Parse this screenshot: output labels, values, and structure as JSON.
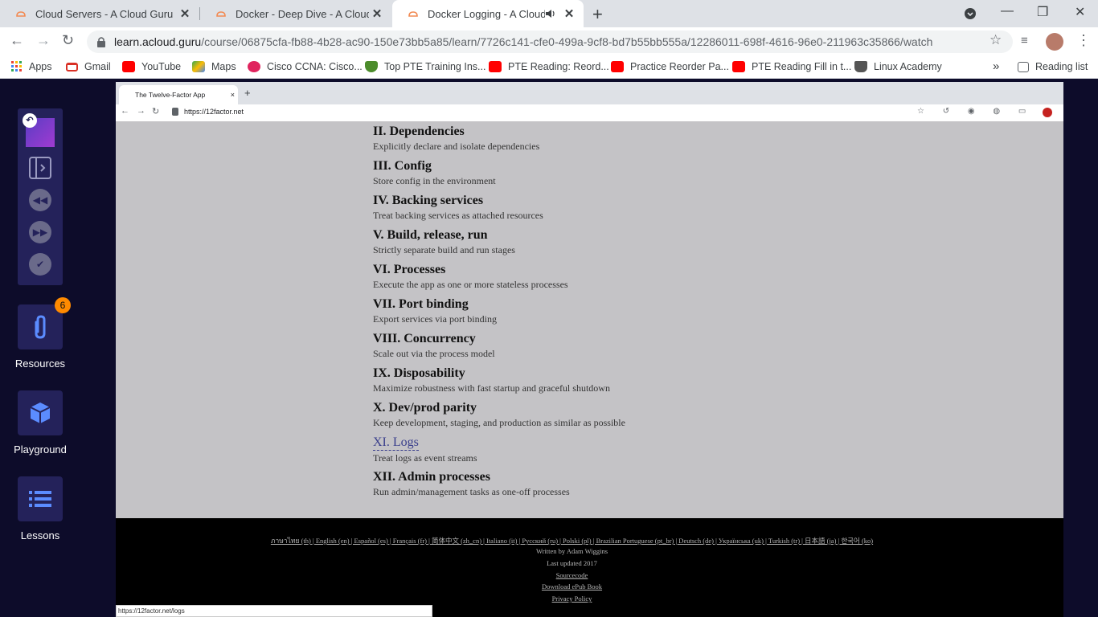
{
  "browser": {
    "tabs": [
      {
        "title": "Cloud Servers - A Cloud Guru",
        "close": "✕"
      },
      {
        "title": "Docker - Deep Dive - A Cloud Gu",
        "close": "✕"
      },
      {
        "title": "Docker Logging - A Cloud G",
        "close": "✕"
      }
    ],
    "new_tab": "+",
    "url_host": "learn.acloud.guru",
    "url_path": "/course/06875cfa-fb88-4b28-ac90-150e73bb5a85/learn/7726c141-cfe0-499a-9cf8-bd7b55bb555a/12286011-698f-4616-96e0-211963c35866/watch",
    "bookmarks": [
      {
        "label": "Apps",
        "icon": "apps-grid-icon",
        "color": "#ea4335"
      },
      {
        "label": "Gmail",
        "icon": "gmail-icon",
        "color": "#d93025"
      },
      {
        "label": "YouTube",
        "icon": "youtube-icon",
        "color": "#ff0000"
      },
      {
        "label": "Maps",
        "icon": "maps-icon",
        "color": "#34a853"
      },
      {
        "label": "Cisco CCNA: Cisco...",
        "icon": "cisco-icon",
        "color": "#e0245e"
      },
      {
        "label": "Top PTE Training Ins...",
        "icon": "shield-icon",
        "color": "#4c8c2b"
      },
      {
        "label": "PTE Reading: Reord...",
        "icon": "youtube-icon",
        "color": "#ff0000"
      },
      {
        "label": "Practice Reorder Pa...",
        "icon": "youtube-icon",
        "color": "#ff0000"
      },
      {
        "label": "PTE Reading Fill in t...",
        "icon": "youtube-icon",
        "color": "#ff0000"
      },
      {
        "label": "Linux Academy",
        "icon": "graduation-cap-icon",
        "color": "#555555"
      }
    ],
    "more": "»",
    "reading_list": "Reading list"
  },
  "sidebar": {
    "badge_count": "6",
    "resources": "Resources",
    "playground": "Playground",
    "lessons": "Lessons"
  },
  "inner": {
    "tab_title": "The Twelve-Factor App",
    "tab_close": "×",
    "new_tab": "+",
    "url": "https://12factor.net",
    "factors": [
      {
        "h": "II. Dependencies",
        "d": "Explicitly declare and isolate dependencies"
      },
      {
        "h": "III. Config",
        "d": "Store config in the environment"
      },
      {
        "h": "IV. Backing services",
        "d": "Treat backing services as attached resources"
      },
      {
        "h": "V. Build, release, run",
        "d": "Strictly separate build and run stages"
      },
      {
        "h": "VI. Processes",
        "d": "Execute the app as one or more stateless processes"
      },
      {
        "h": "VII. Port binding",
        "d": "Export services via port binding"
      },
      {
        "h": "VIII. Concurrency",
        "d": "Scale out via the process model"
      },
      {
        "h": "IX. Disposability",
        "d": "Maximize robustness with fast startup and graceful shutdown"
      },
      {
        "h": "X. Dev/prod parity",
        "d": "Keep development, staging, and production as similar as possible"
      },
      {
        "h": "XI. Logs",
        "d": "Treat logs as event streams"
      },
      {
        "h": "XII. Admin processes",
        "d": "Run admin/management tasks as one-off processes"
      }
    ],
    "footer": {
      "languages": "ภาษาไทย (th) | English (en) | Español (es) | Français (fr) | 简体中文 (zh_cn) | Italiano (it) | Русский (ru) | Polski (pl) | Brazilian Portuguese (pt_br) | Deutsch (de) | Українська (uk) | Turkish (tr) | 日本語 (ja) | 한국어 (ko)",
      "written_by": "Written by Adam Wiggins",
      "updated": "Last updated 2017",
      "sourcecode": "Sourcecode",
      "epub": "Download ePub Book",
      "privacy": "Privacy Policy"
    },
    "status_url": "https://12factor.net/logs"
  }
}
